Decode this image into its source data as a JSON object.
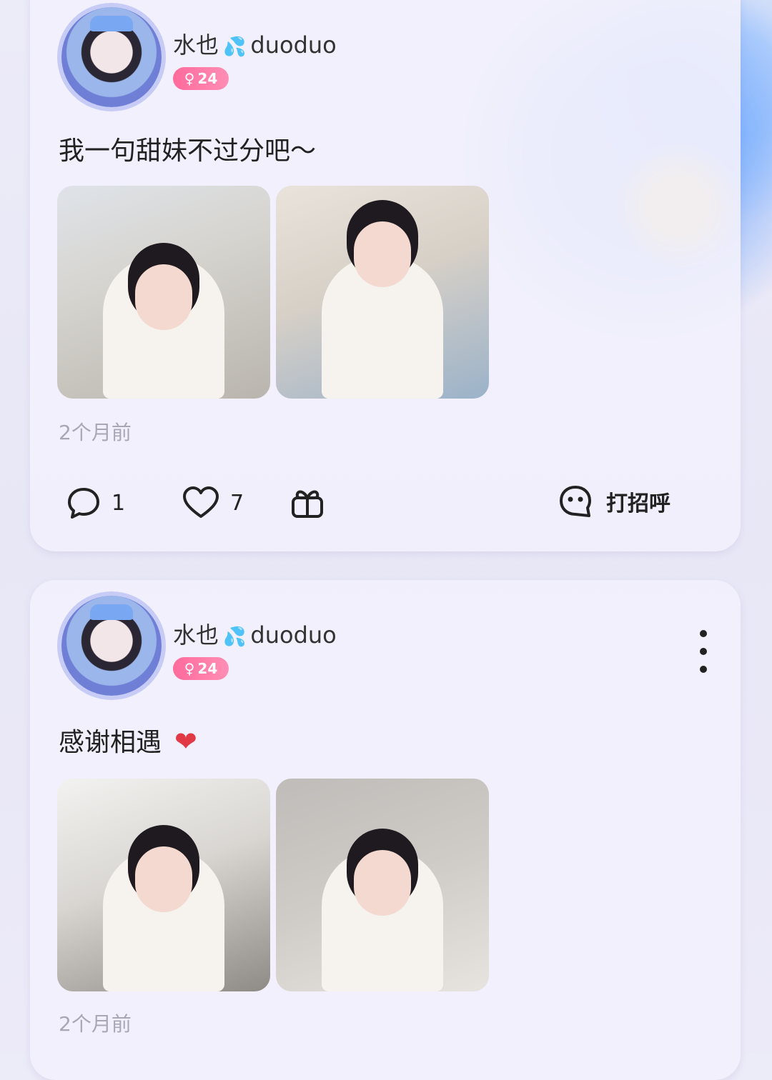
{
  "colors": {
    "background": "#eceaf8",
    "card": "#f1f0fc",
    "badge_gradient_start": "#ff6a9b",
    "badge_gradient_end": "#ff8eb5",
    "muted_text": "#a9a7b6"
  },
  "posts": [
    {
      "username": "水也",
      "username_suffix": "duoduo",
      "badge_age": "24",
      "badge_icon": "female-icon",
      "caption": "我一句甜妹不过分吧～",
      "time": "2个月前",
      "comments": "1",
      "likes": "7",
      "greet_label": "打招呼"
    },
    {
      "username": "水也",
      "username_suffix": "duoduo",
      "badge_age": "24",
      "badge_icon": "female-icon",
      "caption": "感谢相遇",
      "caption_emoji": "❤",
      "time": "2个月前"
    }
  ]
}
